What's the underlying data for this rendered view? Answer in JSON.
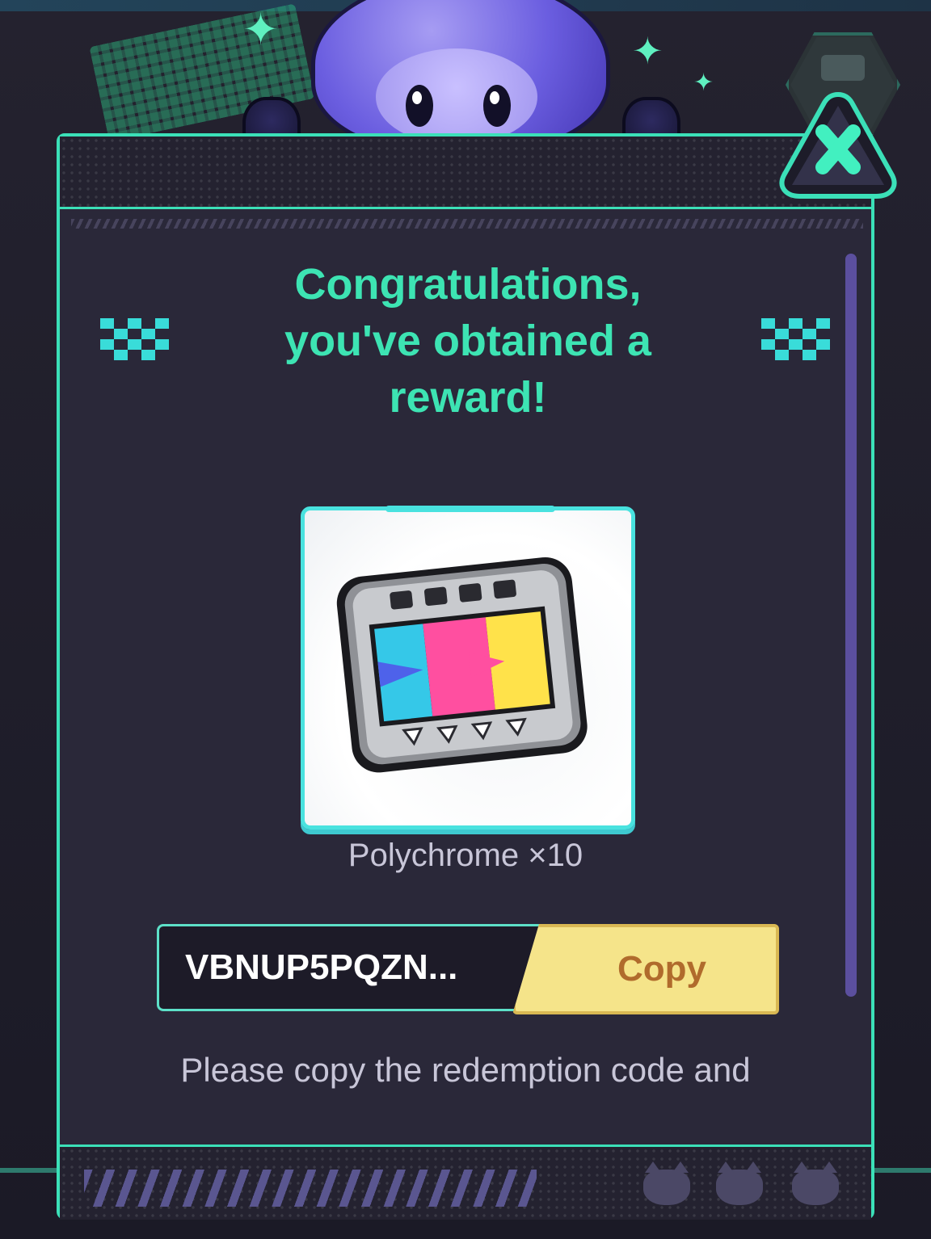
{
  "dialog": {
    "title": "Congratulations, you've obtained a reward!",
    "reward": {
      "item_name": "Polychrome ×10",
      "icon": "film-reel-icon"
    },
    "code": {
      "value": "VBNUP5PQZN...",
      "copy_label": "Copy"
    },
    "hint": "Please copy the redemption code and",
    "close_icon": "close-icon"
  },
  "colors": {
    "accent": "#3de4b3",
    "panel": "#2a2839",
    "copy_button": "#f5e48a",
    "copy_text": "#b06b2c"
  }
}
